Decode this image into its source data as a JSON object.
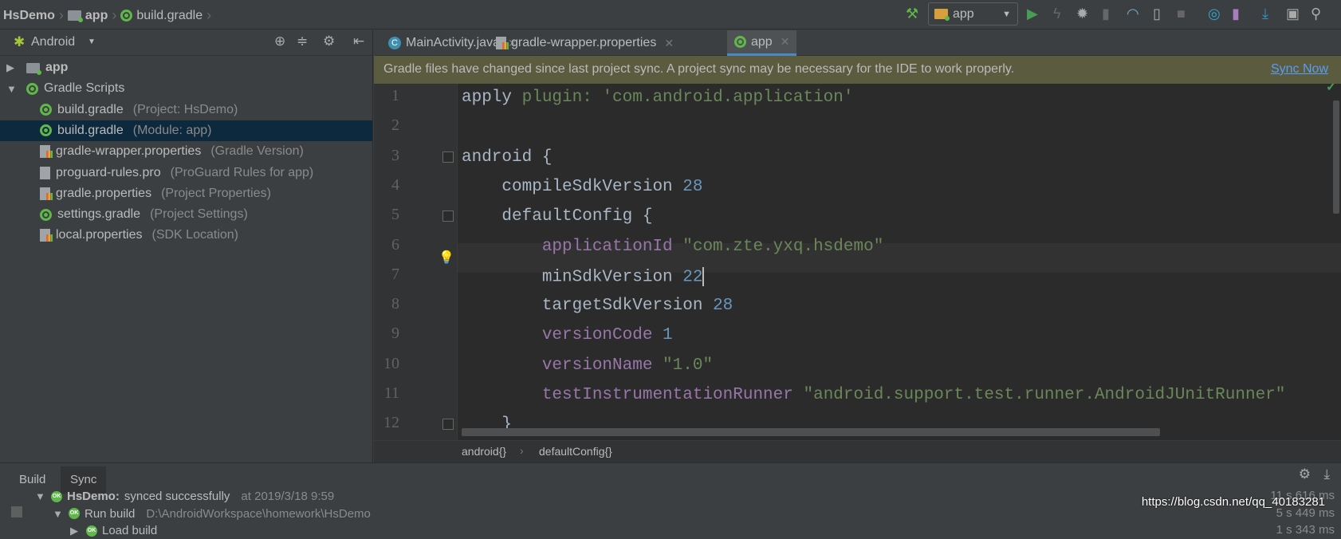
{
  "breadcrumb": [
    "HsDemo",
    "app",
    "build.gradle"
  ],
  "toolbar": {
    "run_config": "app",
    "icons": [
      "build-hammer-icon",
      "run-icon",
      "apply-changes-icon",
      "debug-icon",
      "attach-debugger-icon",
      "profile-icon",
      "device-icon",
      "stop-icon",
      "sync-gradle-icon",
      "avd-manager-icon",
      "sdk-manager-icon",
      "project-structure-icon",
      "search-icon"
    ]
  },
  "project": {
    "view_label": "Android",
    "tree": [
      {
        "label": "app",
        "hint": "",
        "icon": "folder",
        "level": 0,
        "arrow": "▶",
        "bold": true
      },
      {
        "label": "Gradle Scripts",
        "hint": "",
        "icon": "gradle",
        "level": 0,
        "arrow": "▼"
      },
      {
        "label": "build.gradle",
        "hint": "(Project: HsDemo)",
        "icon": "gradle",
        "level": 1
      },
      {
        "label": "build.gradle",
        "hint": "(Module: app)",
        "icon": "gradle",
        "level": 1,
        "selected": true
      },
      {
        "label": "gradle-wrapper.properties",
        "hint": "(Gradle Version)",
        "icon": "props",
        "level": 1
      },
      {
        "label": "proguard-rules.pro",
        "hint": "(ProGuard Rules for app)",
        "icon": "file",
        "level": 1
      },
      {
        "label": "gradle.properties",
        "hint": "(Project Properties)",
        "icon": "props",
        "level": 1
      },
      {
        "label": "settings.gradle",
        "hint": "(Project Settings)",
        "icon": "gradle",
        "level": 1
      },
      {
        "label": "local.properties",
        "hint": "(SDK Location)",
        "icon": "props",
        "level": 1
      }
    ]
  },
  "tabs": [
    {
      "label": "MainActivity.java",
      "icon": "java"
    },
    {
      "label": "gradle-wrapper.properties",
      "icon": "props"
    },
    {
      "label": "app",
      "icon": "gradle",
      "active": true
    }
  ],
  "notification": {
    "message": "Gradle files have changed since last project sync. A project sync may be necessary for the IDE to work properly.",
    "action": "Sync Now"
  },
  "editor": {
    "lines": [
      [
        {
          "t": "apply ",
          "k": ""
        },
        {
          "t": "plugin: 'com.android.application'",
          "k": "str"
        }
      ],
      [],
      [
        {
          "t": "android {",
          "k": ""
        }
      ],
      [
        {
          "t": "    compileSdkVersion ",
          "k": ""
        },
        {
          "t": "28",
          "k": "num"
        }
      ],
      [
        {
          "t": "    defaultConfig {",
          "k": ""
        }
      ],
      [
        {
          "t": "        applicationId ",
          "k": "prop"
        },
        {
          "t": "\"com.zte.yxq.hsdemo\"",
          "k": "str"
        }
      ],
      [
        {
          "t": "        minSdkVersion ",
          "k": ""
        },
        {
          "t": "22",
          "k": "num"
        }
      ],
      [
        {
          "t": "        targetSdkVersion ",
          "k": ""
        },
        {
          "t": "28",
          "k": "num"
        }
      ],
      [
        {
          "t": "        versionCode ",
          "k": "prop"
        },
        {
          "t": "1",
          "k": "num"
        }
      ],
      [
        {
          "t": "        versionName ",
          "k": "prop"
        },
        {
          "t": "\"1.0\"",
          "k": "str"
        }
      ],
      [
        {
          "t": "        testInstrumentationRunner ",
          "k": "prop"
        },
        {
          "t": "\"android.support.test.runner.AndroidJUnitRunner\"",
          "k": "str"
        }
      ],
      [
        {
          "t": "    }",
          "k": ""
        }
      ]
    ],
    "current_line": 7,
    "breadcrumb": [
      "android{}",
      "defaultConfig{}"
    ]
  },
  "build": {
    "tabs": [
      "Build",
      "Sync"
    ],
    "active_tab": "Sync",
    "rows": [
      {
        "name": "HsDemo:",
        "text": "synced successfully",
        "extra": "at 2019/3/18 9:59",
        "duration": "11 s 616 ms",
        "arrow": "▼"
      },
      {
        "name": "Run build",
        "text": "",
        "extra": "D:\\AndroidWorkspace\\homework\\HsDemo",
        "duration": "5 s 449 ms",
        "arrow": "▼"
      },
      {
        "name": "Load build",
        "text": "",
        "extra": "",
        "duration": "1 s 343 ms",
        "arrow": "▶"
      }
    ]
  },
  "watermark": "https://blog.csdn.net/qq_40183281"
}
